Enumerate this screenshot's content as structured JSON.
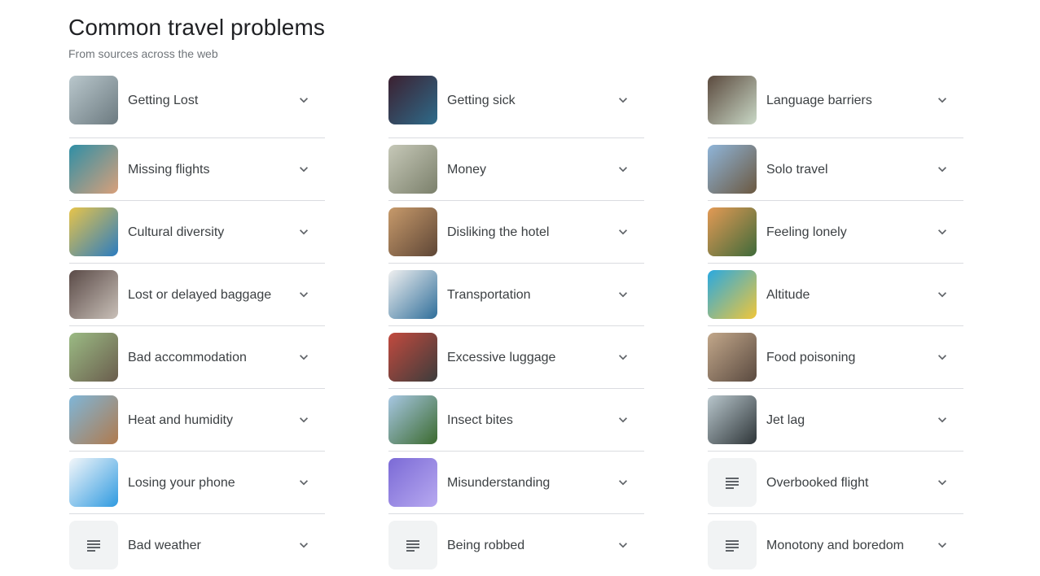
{
  "header": {
    "title": "Common travel problems",
    "subtitle": "From sources across the web"
  },
  "columns": [
    [
      {
        "label": "Getting Lost",
        "thumb": "photo",
        "c1": "#b9c7cc",
        "c2": "#6c7a80"
      },
      {
        "label": "Missing flights",
        "thumb": "photo",
        "c1": "#2f8fa6",
        "c2": "#d9a07a"
      },
      {
        "label": "Cultural diversity",
        "thumb": "photo",
        "c1": "#e7c44a",
        "c2": "#2b7cc0"
      },
      {
        "label": "Lost or delayed baggage",
        "thumb": "photo",
        "c1": "#5a4a47",
        "c2": "#c9c0b8"
      },
      {
        "label": "Bad accommodation",
        "thumb": "photo",
        "c1": "#9bbb84",
        "c2": "#6a5d4d"
      },
      {
        "label": "Heat and humidity",
        "thumb": "photo",
        "c1": "#7fb6d8",
        "c2": "#b07a4d"
      },
      {
        "label": "Losing your phone",
        "thumb": "photo",
        "c1": "#f4f7fa",
        "c2": "#2f9ae0"
      },
      {
        "label": "Bad weather",
        "thumb": "doc"
      }
    ],
    [
      {
        "label": "Getting sick",
        "thumb": "photo",
        "c1": "#3c2030",
        "c2": "#2e6b8a"
      },
      {
        "label": "Money",
        "thumb": "photo",
        "c1": "#c6c8b8",
        "c2": "#7b806b"
      },
      {
        "label": "Disliking the hotel",
        "thumb": "photo",
        "c1": "#c79a6b",
        "c2": "#5e4636"
      },
      {
        "label": "Transportation",
        "thumb": "photo",
        "c1": "#f0f0f0",
        "c2": "#2f6e9a"
      },
      {
        "label": "Excessive luggage",
        "thumb": "photo",
        "c1": "#c24a3e",
        "c2": "#3c3c3c"
      },
      {
        "label": "Insect bites",
        "thumb": "photo",
        "c1": "#a7c7e3",
        "c2": "#3b6a2e"
      },
      {
        "label": "Misunderstanding",
        "thumb": "photo",
        "c1": "#7b6ad6",
        "c2": "#b7a9f0"
      },
      {
        "label": "Being robbed",
        "thumb": "doc"
      }
    ],
    [
      {
        "label": "Language barriers",
        "thumb": "photo",
        "c1": "#5b4a3e",
        "c2": "#c9d8c6"
      },
      {
        "label": "Solo travel",
        "thumb": "photo",
        "c1": "#8fb5d9",
        "c2": "#6b5840"
      },
      {
        "label": "Feeling lonely",
        "thumb": "photo",
        "c1": "#e39a55",
        "c2": "#3f6a3a"
      },
      {
        "label": "Altitude",
        "thumb": "photo",
        "c1": "#2aa9e0",
        "c2": "#f0c63a"
      },
      {
        "label": "Food poisoning",
        "thumb": "photo",
        "c1": "#c2a78a",
        "c2": "#5a4a40"
      },
      {
        "label": "Jet lag",
        "thumb": "photo",
        "c1": "#b8c6cc",
        "c2": "#2e3538"
      },
      {
        "label": "Overbooked flight",
        "thumb": "doc"
      },
      {
        "label": "Monotony and boredom",
        "thumb": "doc"
      }
    ]
  ]
}
